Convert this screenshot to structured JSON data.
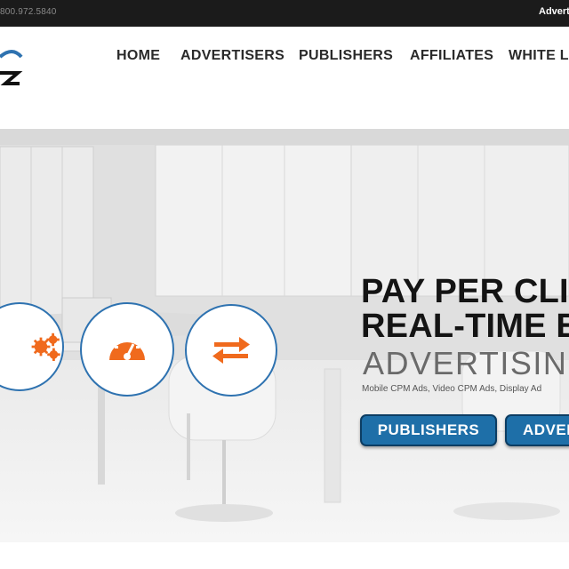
{
  "topbar": {
    "phone": "800.972.5840",
    "advertise_link": "Advert"
  },
  "nav": {
    "items": [
      {
        "label": "HOME"
      },
      {
        "label": "ADVERTISERS"
      },
      {
        "label": "PUBLISHERS"
      },
      {
        "label": "AFFILIATES"
      },
      {
        "label": "WHITE L"
      }
    ]
  },
  "hero": {
    "headline_1": "PAY PER CLIC",
    "headline_2": "REAL-TIME E",
    "advertising": "ADVERTISIN",
    "subtitle": "Mobile CPM Ads, Video CPM Ads, Display Ad",
    "buttons": [
      {
        "label": "PUBLISHERS"
      },
      {
        "label": "ADVER"
      }
    ],
    "feature_icons": [
      "gears-icon",
      "speedometer-icon",
      "transfer-arrows-icon"
    ]
  },
  "colors": {
    "accent_orange": "#f06a1d",
    "button_blue": "#1e6fa8",
    "circle_border": "#2e72b0",
    "topbar": "#1b1b1b"
  }
}
